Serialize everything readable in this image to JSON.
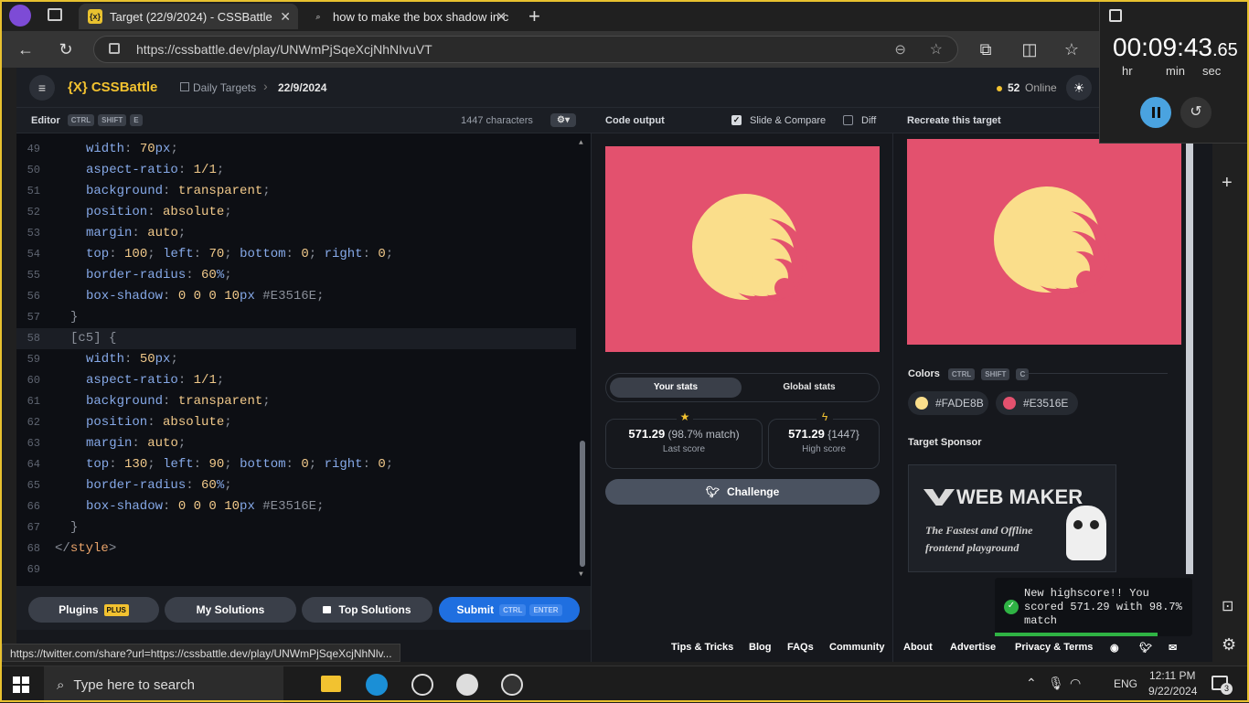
{
  "browser": {
    "tabs": [
      {
        "title": "Target (22/9/2024) - CSSBattle",
        "active": true,
        "favicon": "{x}"
      },
      {
        "title": "how to make the box shadow in c",
        "active": false,
        "favicon": "search-icon"
      }
    ],
    "url": "https://cssbattle.dev/play/UNWmPjSqeXcjNhNIvuVT",
    "status_url": "https://twitter.com/share?url=https://cssbattle.dev/play/UNWmPjSqeXcjNhNlv..."
  },
  "header": {
    "logo": "{X} CSSBattle",
    "breadcrumb_section": "Daily Targets",
    "breadcrumb_current": "22/9/2024",
    "online_count": "52",
    "online_label": "Online"
  },
  "editor": {
    "title": "Editor",
    "shortcut": [
      "CTRL",
      "SHIFT",
      "E"
    ],
    "char_count": "1447 characters",
    "lines": [
      {
        "n": "49",
        "tokens": [
          [
            "pr",
            "width"
          ],
          [
            "pu",
            ": "
          ],
          [
            "vl",
            "70"
          ],
          [
            "pr",
            "px"
          ],
          [
            "pu",
            ";"
          ]
        ]
      },
      {
        "n": "50",
        "tokens": [
          [
            "pr",
            "aspect-ratio"
          ],
          [
            "pu",
            ": "
          ],
          [
            "vl",
            "1/1"
          ],
          [
            "pu",
            ";"
          ]
        ]
      },
      {
        "n": "51",
        "tokens": [
          [
            "pr",
            "background"
          ],
          [
            "pu",
            ": "
          ],
          [
            "vl",
            "transparent"
          ],
          [
            "pu",
            ";"
          ]
        ]
      },
      {
        "n": "52",
        "tokens": [
          [
            "pr",
            "position"
          ],
          [
            "pu",
            ": "
          ],
          [
            "vl",
            "absolute"
          ],
          [
            "pu",
            ";"
          ]
        ]
      },
      {
        "n": "53",
        "tokens": [
          [
            "pr",
            "margin"
          ],
          [
            "pu",
            ": "
          ],
          [
            "vl",
            "auto"
          ],
          [
            "pu",
            ";"
          ]
        ]
      },
      {
        "n": "54",
        "tokens": [
          [
            "pr",
            "top"
          ],
          [
            "pu",
            ": "
          ],
          [
            "vl",
            "100"
          ],
          [
            "pu",
            "; "
          ],
          [
            "pr",
            "left"
          ],
          [
            "pu",
            ": "
          ],
          [
            "vl",
            "70"
          ],
          [
            "pu",
            "; "
          ],
          [
            "pr",
            "bottom"
          ],
          [
            "pu",
            ": "
          ],
          [
            "vl",
            "0"
          ],
          [
            "pu",
            "; "
          ],
          [
            "pr",
            "right"
          ],
          [
            "pu",
            ": "
          ],
          [
            "vl",
            "0"
          ],
          [
            "pu",
            ";"
          ]
        ]
      },
      {
        "n": "55",
        "tokens": [
          [
            "pr",
            "border-radius"
          ],
          [
            "pu",
            ": "
          ],
          [
            "vl",
            "60"
          ],
          [
            "pr",
            "%"
          ],
          [
            "pu",
            ";"
          ]
        ]
      },
      {
        "n": "56",
        "tokens": [
          [
            "pr",
            "box-shadow"
          ],
          [
            "pu",
            ": "
          ],
          [
            "vl",
            "0 0 0 10"
          ],
          [
            "pr",
            "px "
          ],
          [
            "pu",
            "#E3516E;"
          ]
        ]
      },
      {
        "n": "57",
        "tokens": [
          [
            "pu",
            "}"
          ]
        ],
        "indent": 1
      },
      {
        "n": "58",
        "tokens": [
          [
            "pu",
            "[c5] {"
          ]
        ],
        "indent": 1,
        "current": true
      },
      {
        "n": "59",
        "tokens": [
          [
            "pr",
            "width"
          ],
          [
            "pu",
            ": "
          ],
          [
            "vl",
            "50"
          ],
          [
            "pr",
            "px"
          ],
          [
            "pu",
            ";"
          ]
        ]
      },
      {
        "n": "60",
        "tokens": [
          [
            "pr",
            "aspect-ratio"
          ],
          [
            "pu",
            ": "
          ],
          [
            "vl",
            "1/1"
          ],
          [
            "pu",
            ";"
          ]
        ]
      },
      {
        "n": "61",
        "tokens": [
          [
            "pr",
            "background"
          ],
          [
            "pu",
            ": "
          ],
          [
            "vl",
            "transparent"
          ],
          [
            "pu",
            ";"
          ]
        ]
      },
      {
        "n": "62",
        "tokens": [
          [
            "pr",
            "position"
          ],
          [
            "pu",
            ": "
          ],
          [
            "vl",
            "absolute"
          ],
          [
            "pu",
            ";"
          ]
        ]
      },
      {
        "n": "63",
        "tokens": [
          [
            "pr",
            "margin"
          ],
          [
            "pu",
            ": "
          ],
          [
            "vl",
            "auto"
          ],
          [
            "pu",
            ";"
          ]
        ]
      },
      {
        "n": "64",
        "tokens": [
          [
            "pr",
            "top"
          ],
          [
            "pu",
            ": "
          ],
          [
            "vl",
            "130"
          ],
          [
            "pu",
            "; "
          ],
          [
            "pr",
            "left"
          ],
          [
            "pu",
            ": "
          ],
          [
            "vl",
            "90"
          ],
          [
            "pu",
            "; "
          ],
          [
            "pr",
            "bottom"
          ],
          [
            "pu",
            ": "
          ],
          [
            "vl",
            "0"
          ],
          [
            "pu",
            "; "
          ],
          [
            "pr",
            "right"
          ],
          [
            "pu",
            ": "
          ],
          [
            "vl",
            "0"
          ],
          [
            "pu",
            ";"
          ]
        ]
      },
      {
        "n": "65",
        "tokens": [
          [
            "pr",
            "border-radius"
          ],
          [
            "pu",
            ": "
          ],
          [
            "vl",
            "60"
          ],
          [
            "pr",
            "%"
          ],
          [
            "pu",
            ";"
          ]
        ]
      },
      {
        "n": "66",
        "tokens": [
          [
            "pr",
            "box-shadow"
          ],
          [
            "pu",
            ": "
          ],
          [
            "vl",
            "0 0 0 10"
          ],
          [
            "pr",
            "px "
          ],
          [
            "pu",
            "#E3516E;"
          ]
        ]
      },
      {
        "n": "67",
        "tokens": [
          [
            "pu",
            "}"
          ]
        ],
        "indent": 1
      },
      {
        "n": "68",
        "tokens": [
          [
            "pu",
            "</"
          ],
          [
            "sl",
            "style"
          ],
          [
            "pu",
            ">"
          ]
        ],
        "indent": 0
      },
      {
        "n": "69",
        "tokens": [],
        "indent": 0
      }
    ]
  },
  "bottom_buttons": {
    "plugins": "Plugins",
    "plugins_badge": "PLUS",
    "my_solutions": "My Solutions",
    "top_solutions": "Top Solutions",
    "submit": "Submit",
    "submit_shortcut": [
      "CTRL",
      "ENTER"
    ]
  },
  "output": {
    "title": "Code output",
    "slide_compare": "Slide & Compare",
    "slide_compare_checked": true,
    "diff": "Diff",
    "diff_checked": false,
    "tab_your": "Your stats",
    "tab_global": "Global stats",
    "last_score": "571.29",
    "last_match": "(98.7% match)",
    "last_label": "Last score",
    "high_score": "571.29",
    "high_chars": "{1447}",
    "high_label": "High score",
    "challenge": "Challenge"
  },
  "target": {
    "title": "Recreate this target",
    "size_hint": "40",
    "colors_label": "Colors",
    "colors_shortcut": [
      "CTRL",
      "SHIFT",
      "C"
    ],
    "colors": [
      "#FADE8B",
      "#E3516E"
    ],
    "sponsor_label": "Target Sponsor",
    "sponsor_name": "WEB MAKER",
    "sponsor_tagline_1": "The Fastest and Offline",
    "sponsor_tagline_2": "frontend playground"
  },
  "footer_links": [
    "Tips & Tricks",
    "Blog",
    "FAQs",
    "Community",
    "About",
    "Advertise",
    "Privacy & Terms"
  ],
  "toast": {
    "message": "New highscore!! You scored 571.29 with 98.7% match"
  },
  "timer": {
    "main": "00:09:43",
    "fraction": ".65",
    "hr": "hr",
    "min": "min",
    "sec": "sec"
  },
  "taskbar": {
    "search_placeholder": "Type here to search",
    "lang": "ENG",
    "time": "12:11 PM",
    "date": "9/22/2024",
    "notif_count": "3"
  },
  "colors": {
    "bg_pink": "#E3516E",
    "yellow": "#FADE8B",
    "accent_blue": "#1f6fe0"
  }
}
